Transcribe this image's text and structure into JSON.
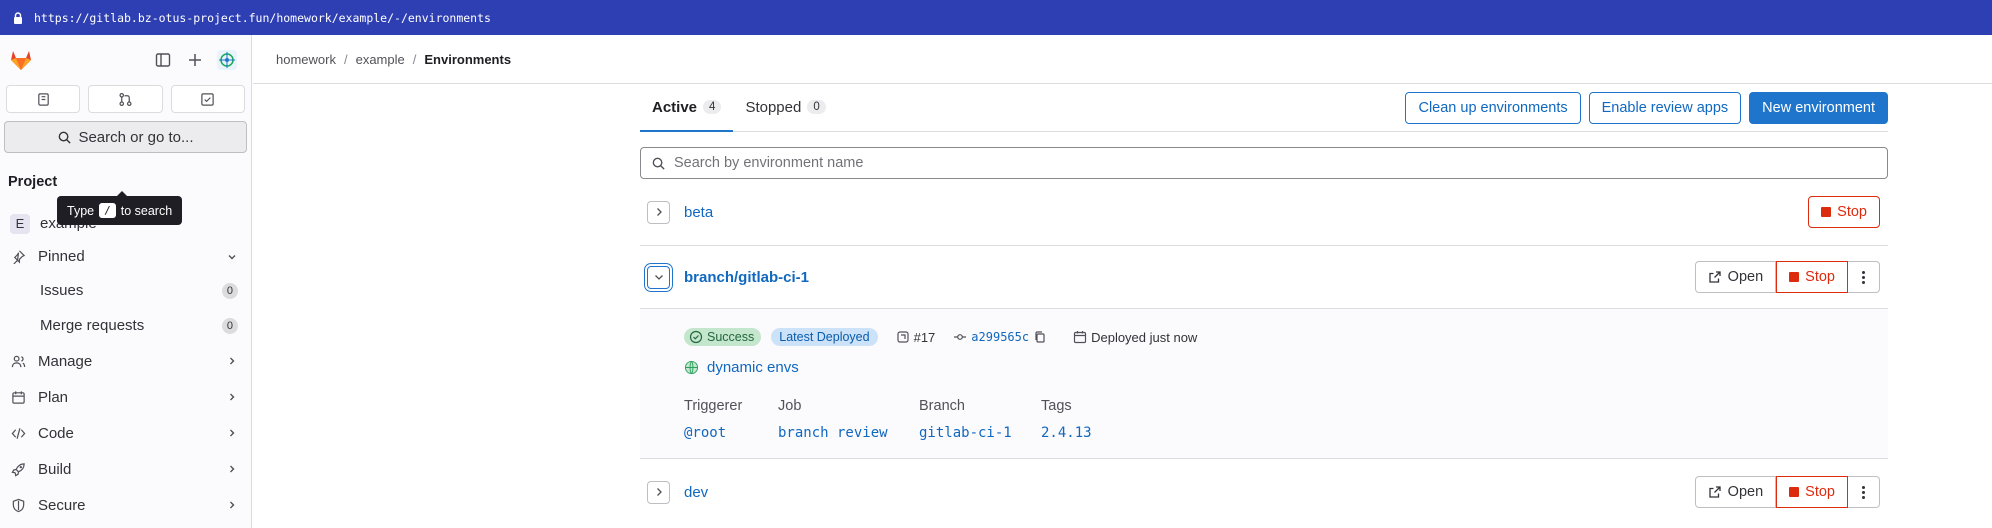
{
  "browser": {
    "url": "https://gitlab.bz-otus-project.fun/homework/example/-/environments"
  },
  "sidebar": {
    "search_label": "Search or go to...",
    "tooltip": {
      "prefix": "Type",
      "key": "/",
      "suffix": "to search"
    },
    "project_heading": "Project",
    "project": {
      "avatar": "E",
      "name": "example"
    },
    "pinned": "Pinned",
    "pinned_items": [
      {
        "label": "Issues",
        "count": "0"
      },
      {
        "label": "Merge requests",
        "count": "0"
      }
    ],
    "sections": [
      {
        "label": "Manage",
        "icon": "users-icon"
      },
      {
        "label": "Plan",
        "icon": "calendar-icon"
      },
      {
        "label": "Code",
        "icon": "code-icon"
      },
      {
        "label": "Build",
        "icon": "rocket-icon"
      },
      {
        "label": "Secure",
        "icon": "shield-icon"
      }
    ]
  },
  "breadcrumb": [
    "homework",
    "example",
    "Environments"
  ],
  "tabs": [
    {
      "label": "Active",
      "count": "4"
    },
    {
      "label": "Stopped",
      "count": "0"
    }
  ],
  "actions": {
    "cleanup": "Clean up environments",
    "review_apps": "Enable review apps",
    "new_env": "New environment"
  },
  "search": {
    "placeholder": "Search by environment name"
  },
  "environments": [
    {
      "name": "beta",
      "stop": "Stop"
    },
    {
      "name": "branch/gitlab-ci-1",
      "open": "Open",
      "stop": "Stop",
      "deployment": {
        "status": "Success",
        "latest": "Latest Deployed",
        "id": "#17",
        "commit": "a299565c",
        "deployed": "Deployed just now",
        "url_label": "dynamic envs",
        "headers": [
          "Triggerer",
          "Job",
          "Branch",
          "Tags"
        ],
        "values": [
          "@root",
          "branch review",
          "gitlab-ci-1",
          "2.4.13"
        ]
      }
    },
    {
      "name": "dev",
      "open": "Open",
      "stop": "Stop"
    }
  ]
}
